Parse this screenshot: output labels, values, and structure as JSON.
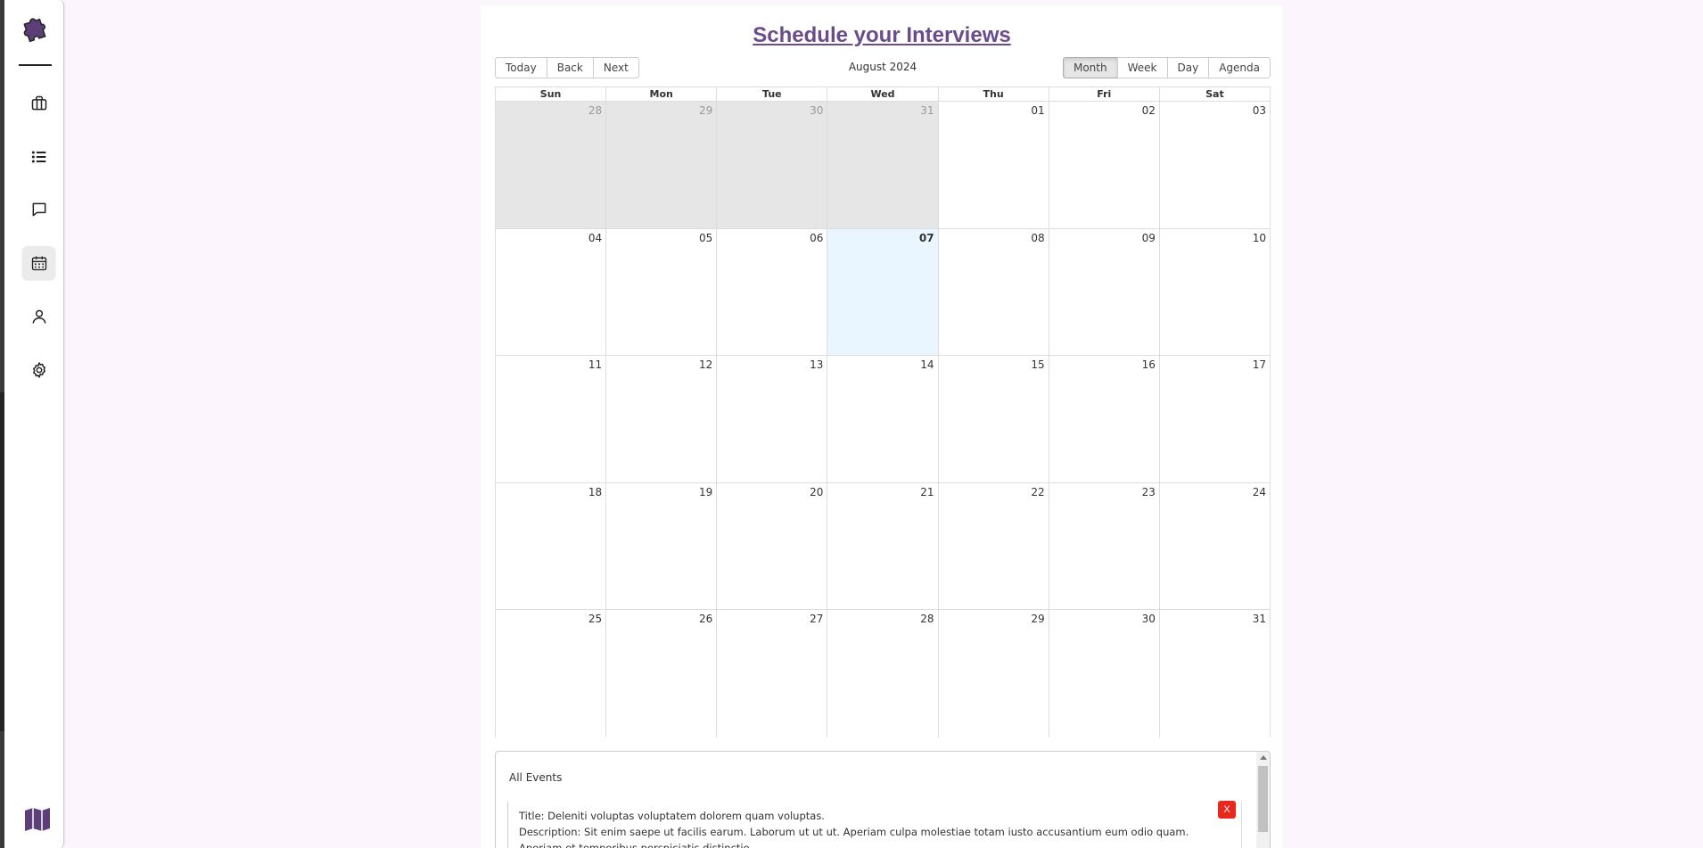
{
  "page": {
    "title": "Schedule your Interviews"
  },
  "sidebar": {
    "items": [
      {
        "icon": "briefcase-icon"
      },
      {
        "icon": "list-icon"
      },
      {
        "icon": "chat-icon"
      },
      {
        "icon": "calendar-icon",
        "active": true
      },
      {
        "icon": "user-icon"
      },
      {
        "icon": "gear-icon"
      }
    ],
    "bottom_icon": "map-icon"
  },
  "toolbar": {
    "today": "Today",
    "back": "Back",
    "next": "Next",
    "label": "August 2024",
    "views": [
      "Month",
      "Week",
      "Day",
      "Agenda"
    ],
    "active_view": "Month"
  },
  "calendar": {
    "weekdays": [
      "Sun",
      "Mon",
      "Tue",
      "Wed",
      "Thu",
      "Fri",
      "Sat"
    ],
    "weeks": [
      [
        "28",
        "29",
        "30",
        "31",
        "01",
        "02",
        "03"
      ],
      [
        "04",
        "05",
        "06",
        "07",
        "08",
        "09",
        "10"
      ],
      [
        "11",
        "12",
        "13",
        "14",
        "15",
        "16",
        "17"
      ],
      [
        "18",
        "19",
        "20",
        "21",
        "22",
        "23",
        "24"
      ],
      [
        "25",
        "26",
        "27",
        "28",
        "29",
        "30",
        "31"
      ]
    ],
    "off_range_days": [
      "28",
      "29",
      "30",
      "31"
    ],
    "today": "07"
  },
  "events": {
    "heading": "All Events",
    "items": [
      {
        "title": "Title: Deleniti voluptas voluptatem dolorem quam voluptas.",
        "description": "Description: Sit enim saepe ut facilis earum. Laborum ut ut ut. Aperiam culpa molestiae totam iusto accusantium eum odio quam. Aperiam et temporibus perspiciatis distinctio.",
        "delete_label": "X"
      }
    ]
  },
  "colors": {
    "title": "#6b4c8a",
    "background": "#fdf5fe",
    "today_cell": "#eaf6ff",
    "off_range_cell": "#e6e6e6",
    "delete_button": "#e8281c"
  }
}
